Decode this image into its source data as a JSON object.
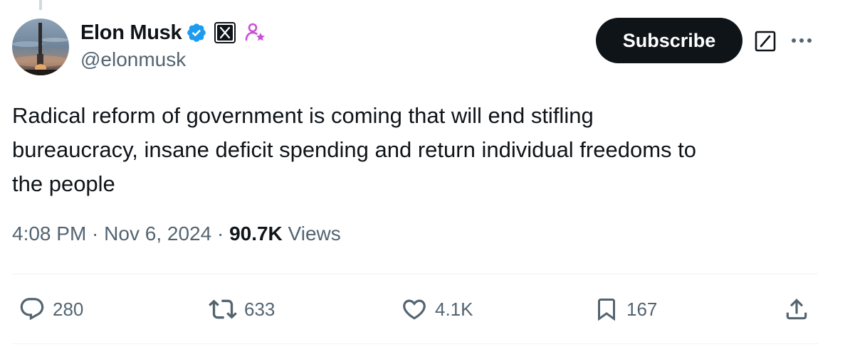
{
  "author": {
    "name": "Elon Musk",
    "handle": "@elonmusk",
    "verified_color": "#1d9bf0",
    "affiliate_icon": "x-logo-icon",
    "subscriber_icon": "person-star-icon"
  },
  "actions_top": {
    "subscribe_label": "Subscribe",
    "grok_icon": "grok-icon",
    "more_icon": "more-icon"
  },
  "tweet": {
    "text": "Radical reform of government is coming that will end stifling\nbureaucracy, insane deficit spending and return individual freedoms to\nthe people",
    "time": "4:08 PM",
    "separator": " · ",
    "date": "Nov 6, 2024",
    "views_count": "90.7K",
    "views_label": " Views"
  },
  "engagement": {
    "replies": "280",
    "reposts": "633",
    "likes": "4.1K",
    "bookmarks": "167"
  },
  "colors": {
    "text_primary": "#0f1419",
    "text_secondary": "#536471",
    "subscriber_purple": "#c94fd9"
  }
}
